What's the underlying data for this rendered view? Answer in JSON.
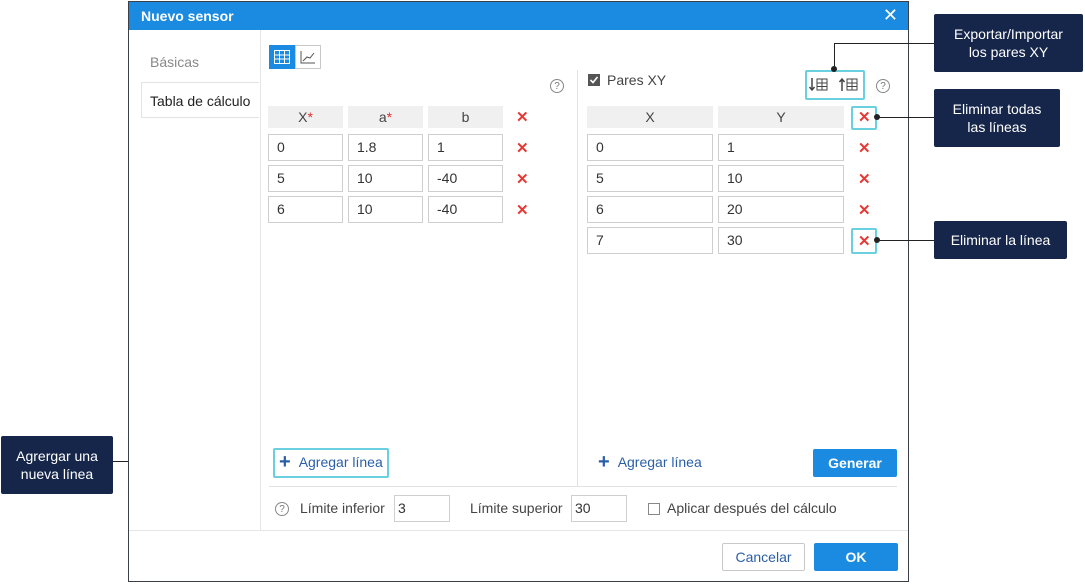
{
  "dialog": {
    "title": "Nuevo sensor",
    "close_label": "✕"
  },
  "sidebar": {
    "items": [
      {
        "label": "Básicas"
      },
      {
        "label": "Tabla de cálculo"
      }
    ]
  },
  "left_table": {
    "headers": [
      "X",
      "a",
      "b"
    ],
    "rows": [
      [
        "0",
        "1.8",
        "1"
      ],
      [
        "5",
        "10",
        "-40"
      ],
      [
        "6",
        "10",
        "-40"
      ]
    ],
    "add_label": "Agregar línea"
  },
  "right_table": {
    "checkbox_label": "Pares XY",
    "headers": [
      "X",
      "Y"
    ],
    "rows": [
      [
        "0",
        "1"
      ],
      [
        "5",
        "10"
      ],
      [
        "6",
        "20"
      ],
      [
        "7",
        "30"
      ]
    ],
    "add_label": "Agregar línea",
    "generate_label": "Generar"
  },
  "footer": {
    "lower_label": "Límite inferior",
    "lower_value": "3",
    "upper_label": "Límite superior",
    "upper_value": "30",
    "apply_label": "Aplicar después del cálculo",
    "cancel_label": "Cancelar",
    "ok_label": "OK"
  },
  "callouts": {
    "export_import": "Exportar/Importar los pares XY",
    "delete_all": "Eliminar todas las líneas",
    "delete_line": "Eliminar la línea",
    "add_line": "Agrergar una nueva línea"
  },
  "help_glyph": "?",
  "delete_glyph": "✕",
  "required_glyph": "*",
  "colors": {
    "accent": "#1a8be0",
    "delete": "#e53935",
    "callout": "#16264a",
    "highlight": "#6ad0df"
  }
}
